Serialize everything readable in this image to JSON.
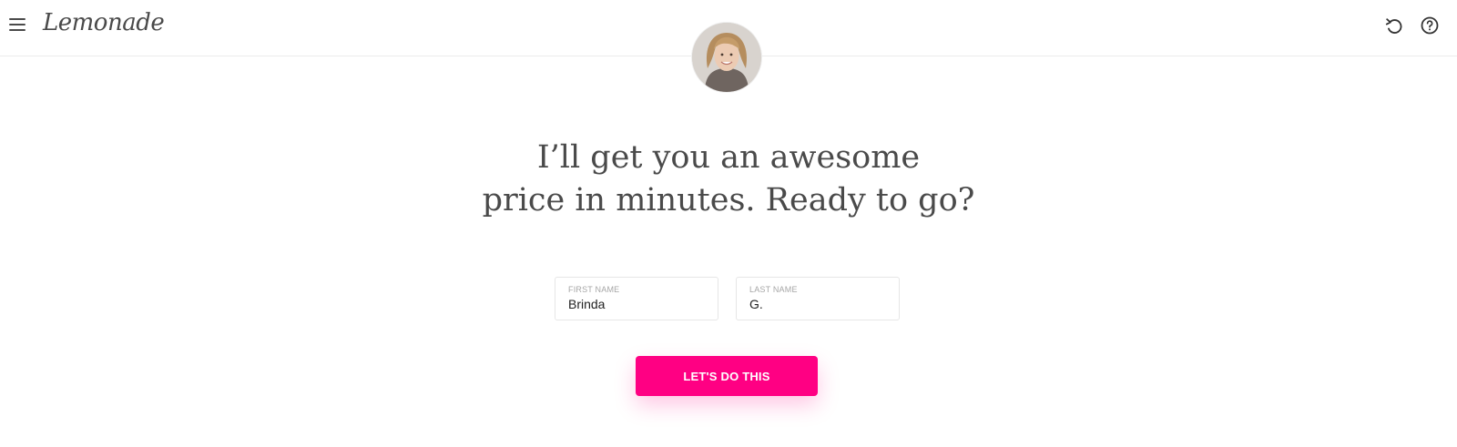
{
  "header": {
    "logo_text": "Lemonade",
    "menu_icon": "hamburger-menu-icon",
    "actions": [
      {
        "name": "undo",
        "icon": "undo-icon"
      },
      {
        "name": "help",
        "icon": "help-circle-icon"
      }
    ]
  },
  "hero": {
    "avatar_icon": "assistant-avatar",
    "headline_line1": "I’ll get you an awesome",
    "headline_line2": "price in minutes. Ready to go?"
  },
  "form": {
    "first_name": {
      "label": "FIRST NAME",
      "value": "Brinda"
    },
    "last_name": {
      "label": "LAST NAME",
      "value": "G."
    },
    "submit_label": "LET'S DO THIS"
  },
  "colors": {
    "accent": "#ff0083",
    "text": "#4a4a4a",
    "border": "#e6e6e6"
  }
}
